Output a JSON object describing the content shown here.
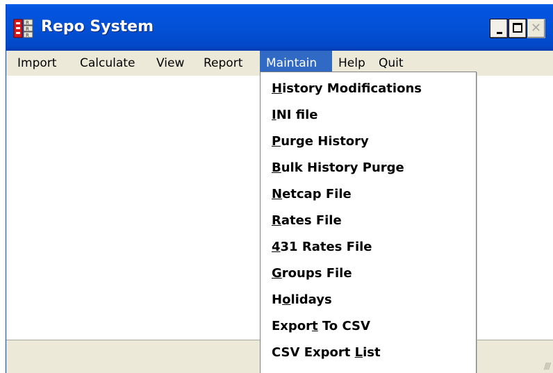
{
  "window": {
    "title": "Repo System",
    "controls": {
      "minimize": "minimize",
      "maximize": "maximize",
      "close": "close"
    }
  },
  "menubar": {
    "items": [
      {
        "label": "Import"
      },
      {
        "label": "Calculate"
      },
      {
        "label": "View"
      },
      {
        "label": "Report"
      },
      {
        "label": "Maintain",
        "active": true
      },
      {
        "label": "Help"
      },
      {
        "label": "Quit"
      }
    ]
  },
  "maintain_menu": {
    "items": [
      {
        "pre": "",
        "key": "H",
        "post": "istory Modifications"
      },
      {
        "pre": "",
        "key": "I",
        "post": "NI file"
      },
      {
        "pre": "",
        "key": "P",
        "post": "urge History"
      },
      {
        "pre": "",
        "key": "B",
        "post": "ulk History Purge"
      },
      {
        "pre": "",
        "key": "N",
        "post": "etcap File"
      },
      {
        "pre": "",
        "key": "R",
        "post": "ates File"
      },
      {
        "pre": "",
        "key": "4",
        "post": "31 Rates File"
      },
      {
        "pre": "",
        "key": "G",
        "post": "roups File"
      },
      {
        "pre": "H",
        "key": "o",
        "post": "lidays"
      },
      {
        "pre": "Expor",
        "key": "t",
        "post": " To CSV"
      },
      {
        "pre": "CSV Export ",
        "key": "L",
        "post": "ist"
      }
    ]
  },
  "colors": {
    "titlebar": "#0351d6",
    "menu_highlight": "#316ac5",
    "menubar_bg": "#ece9d8"
  }
}
